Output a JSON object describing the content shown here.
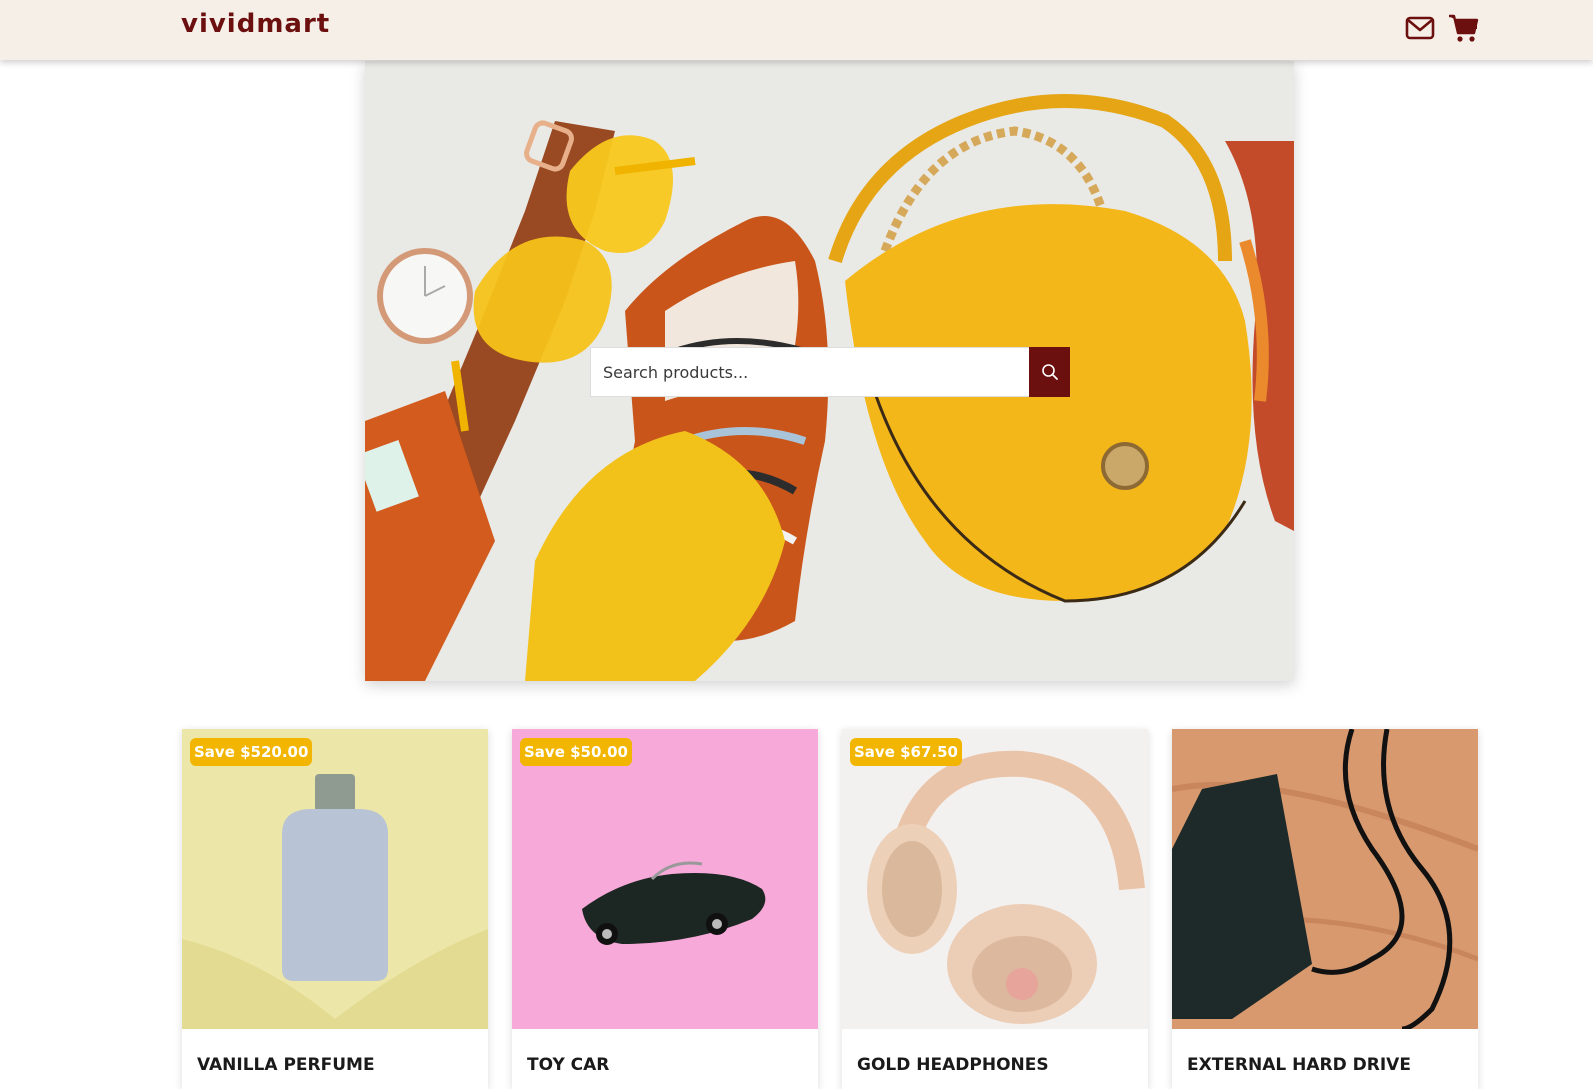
{
  "header": {
    "logo": "vividmart",
    "mail_icon": "mail-icon",
    "cart_icon": "cart-icon"
  },
  "hero": {
    "search": {
      "placeholder": "Search products...",
      "button_icon": "search-icon"
    }
  },
  "products": [
    {
      "badge": "Save $520.00",
      "name": "VANILLA PERFUME"
    },
    {
      "badge": "Save $50.00",
      "name": "TOY CAR"
    },
    {
      "badge": "Save $67.50",
      "name": "GOLD HEADPHONES"
    },
    {
      "badge": "",
      "name": "EXTERNAL HARD DRIVE"
    }
  ],
  "colors": {
    "brand": "#6b0f0f",
    "header_bg": "#f6efe8",
    "badge_bg": "#f2b600"
  }
}
